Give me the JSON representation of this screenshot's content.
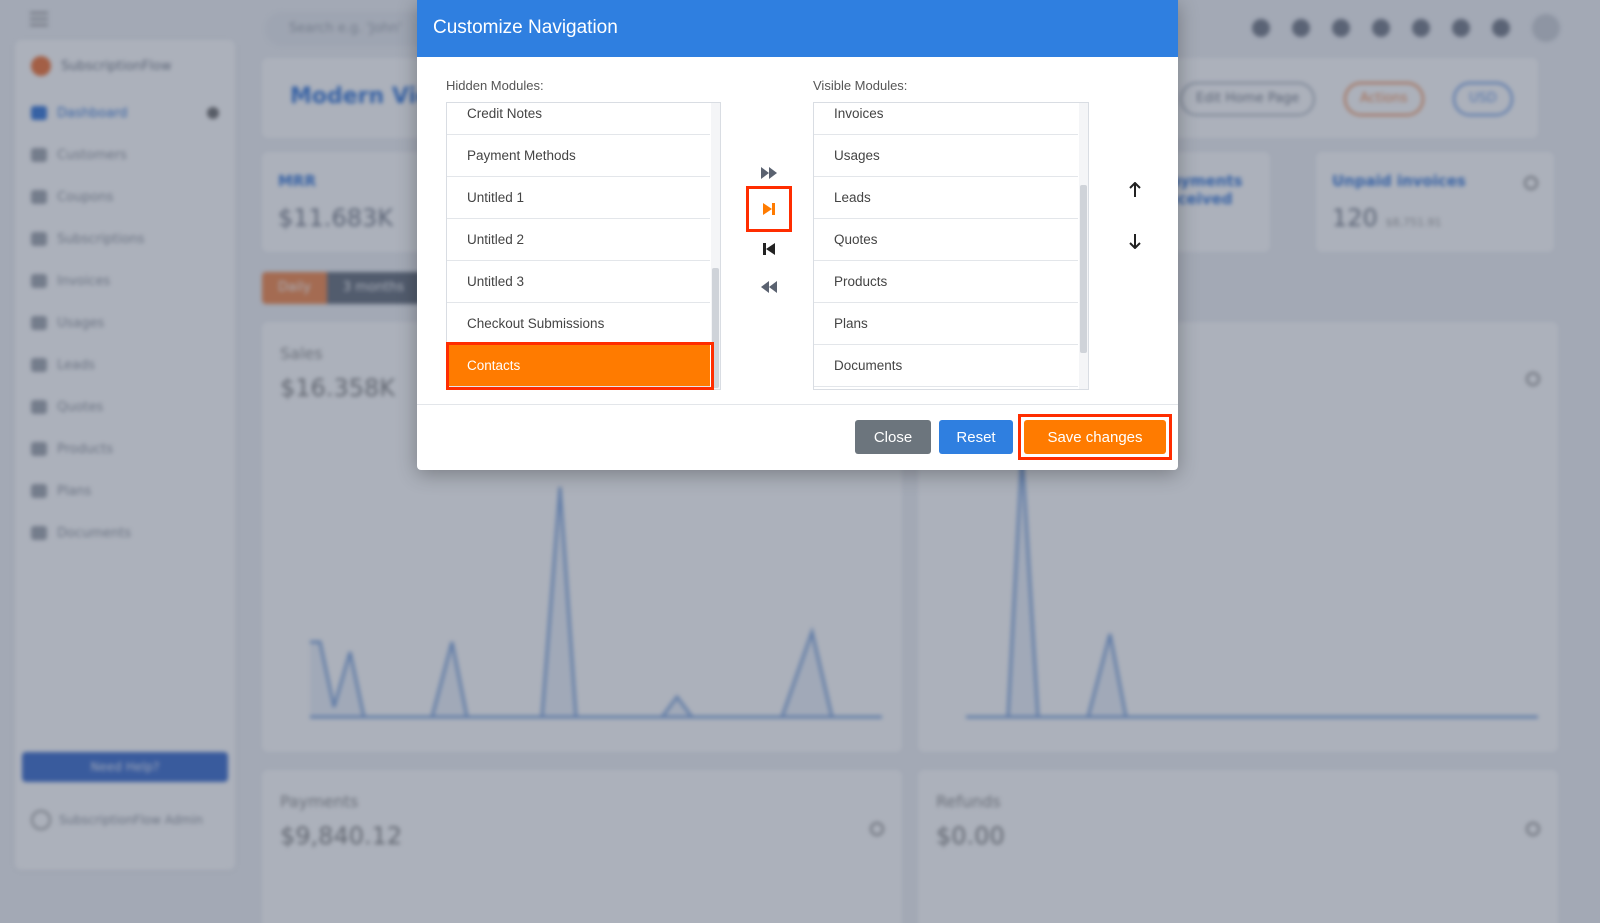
{
  "app": {
    "search_placeholder": "Search e.g. 'John'",
    "brand": "SubscriptionFlow",
    "sidebar": [
      {
        "label": "Dashboard",
        "active": true
      },
      {
        "label": "Customers"
      },
      {
        "label": "Coupons"
      },
      {
        "label": "Subscriptions"
      },
      {
        "label": "Invoices"
      },
      {
        "label": "Usages"
      },
      {
        "label": "Leads"
      },
      {
        "label": "Quotes"
      },
      {
        "label": "Products"
      },
      {
        "label": "Plans"
      },
      {
        "label": "Documents"
      }
    ],
    "help_label": "Need Help?",
    "user_label": "SubscriptionFlow Admin",
    "page_title": "Modern View",
    "header_buttons": {
      "edit": "Edit Home Page",
      "actions": "Actions",
      "currency": "USD"
    },
    "metrics": [
      {
        "label": "MRR",
        "value": "$11.683K"
      },
      {
        "label": "Payments received",
        "value": ""
      },
      {
        "label": "Unpaid invoices",
        "value": "120",
        "sub": "$8,751.91"
      }
    ],
    "tabs": [
      "Daily",
      "3 months"
    ],
    "charts": {
      "sales": {
        "label": "Sales",
        "value": "$16.358K"
      },
      "payments": {
        "label": "Payments",
        "value": "$9,840.12"
      },
      "refunds": {
        "label": "Refunds",
        "value": "$0.00"
      }
    }
  },
  "modal": {
    "title": "Customize Navigation",
    "hidden_label": "Hidden Modules:",
    "visible_label": "Visible Modules:",
    "hidden_modules": [
      "Credit Notes",
      "Payment Methods",
      "Untitled 1",
      "Untitled 2",
      "Untitled 3",
      "Checkout Submissions",
      "Contacts"
    ],
    "selected_hidden": "Contacts",
    "visible_modules": [
      "Invoices",
      "Usages",
      "Leads",
      "Quotes",
      "Products",
      "Plans",
      "Documents"
    ],
    "buttons": {
      "close": "Close",
      "reset": "Reset",
      "save": "Save changes"
    },
    "colors": {
      "header": "#2f7fe0",
      "selected": "#ff7b00",
      "highlight": "#ff2d00",
      "close": "#6c757d"
    }
  }
}
